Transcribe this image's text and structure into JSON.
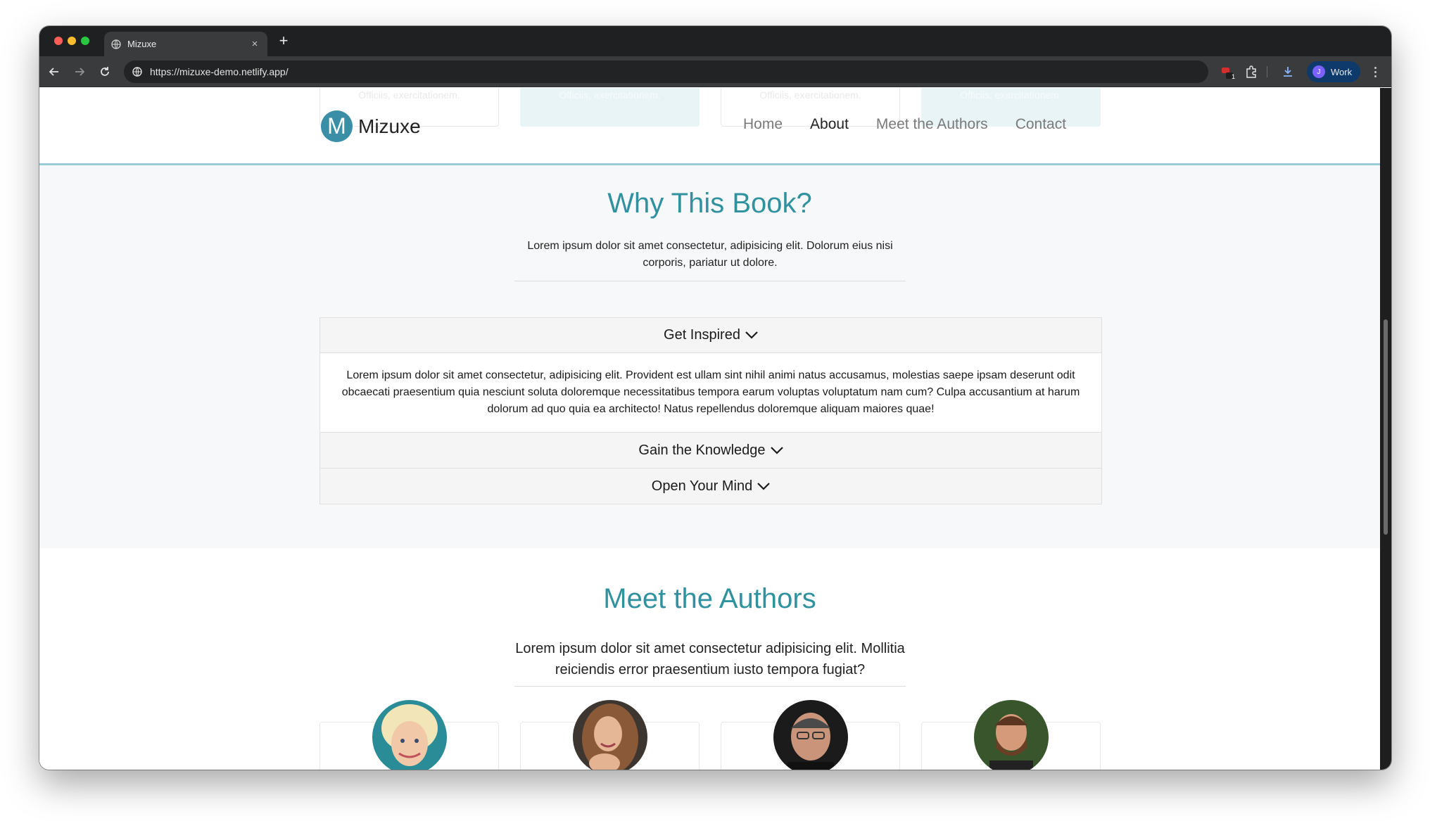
{
  "browser": {
    "tab_title": "Mizuxe",
    "url": "https://mizuxe-demo.netlify.app/",
    "profile_initial": "J",
    "profile_label": "Work",
    "extension_badge": "1"
  },
  "ghost_cards": {
    "text": "Officiis, exercitationem."
  },
  "navbar": {
    "brand_initial": "M",
    "brand_name": "Mizuxe",
    "links": [
      {
        "label": "Home"
      },
      {
        "label": "About"
      },
      {
        "label": "Meet the Authors"
      },
      {
        "label": "Contact"
      }
    ]
  },
  "about": {
    "title": "Why This Book?",
    "lead": "Lorem ipsum dolor sit amet consectetur, adipisicing elit. Dolorum eius nisi corporis, pariatur ut dolore.",
    "accordion": [
      {
        "title": "Get Inspired",
        "body": "Lorem ipsum dolor sit amet consectetur, adipisicing elit. Provident est ullam sint nihil animi natus accusamus, molestias saepe ipsam deserunt odit obcaecati praesentium quia nesciunt soluta doloremque necessitatibus tempora earum voluptas voluptatum nam cum? Culpa accusantium at harum dolorum ad quo quia ea architecto! Natus repellendus doloremque aliquam maiores quae!"
      },
      {
        "title": "Gain the Knowledge"
      },
      {
        "title": "Open Your Mind"
      }
    ]
  },
  "authors": {
    "title": "Meet the Authors",
    "lead": "Lorem ipsum dolor sit amet consectetur adipisicing elit. Mollitia reiciendis error praesentium iusto tempora fugiat?"
  },
  "colors": {
    "accent": "#31929f",
    "logo": "#3a8fa7",
    "navbar_border": "#9ccad6",
    "section_bg": "#f7f8f9"
  }
}
